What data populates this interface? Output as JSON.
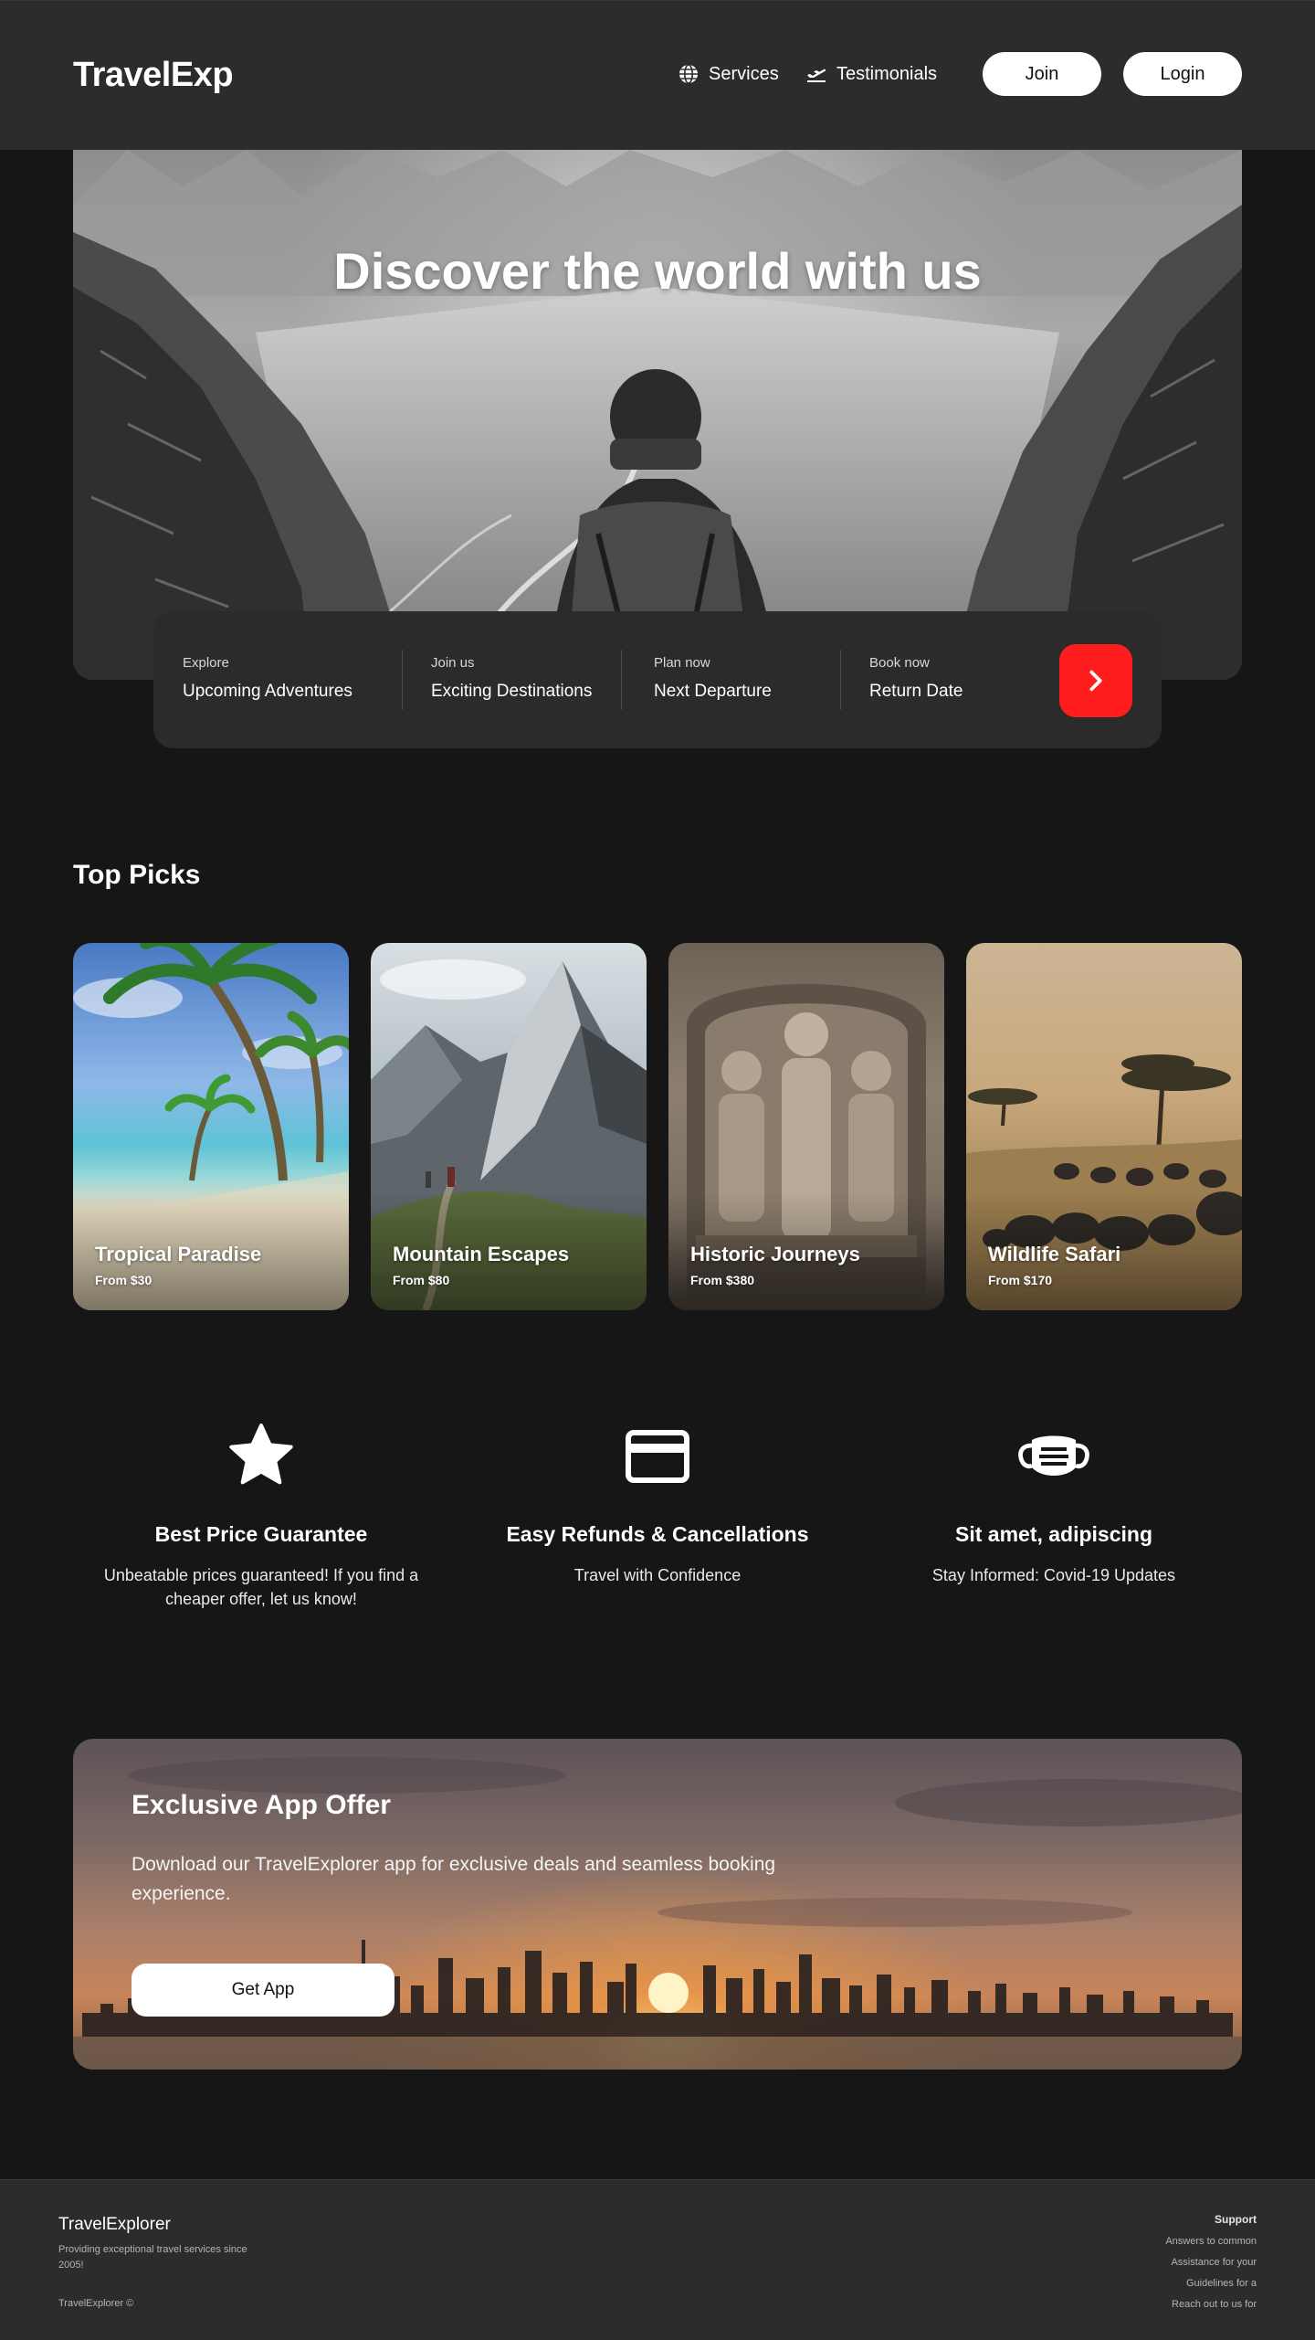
{
  "header": {
    "logo": "TravelExp",
    "nav": [
      {
        "label": "Services",
        "icon": "globe-icon"
      },
      {
        "label": "Testimonials",
        "icon": "plane-departure-icon"
      }
    ],
    "join_label": "Join",
    "login_label": "Login"
  },
  "hero": {
    "title": "Discover the world with us"
  },
  "search": {
    "fields": [
      {
        "label": "Explore",
        "value": "Upcoming Adventures"
      },
      {
        "label": "Join us",
        "value": "Exciting Destinations"
      },
      {
        "label": "Plan now",
        "value": "Next Departure"
      },
      {
        "label": "Book now",
        "value": "Return Date"
      }
    ],
    "submit_icon": "chevron-right-icon",
    "accent_color": "#ff1d1d"
  },
  "top_picks": {
    "title": "Top Picks",
    "cards": [
      {
        "title": "Tropical Paradise",
        "price": "From $30"
      },
      {
        "title": "Mountain Escapes",
        "price": "From $80"
      },
      {
        "title": "Historic Journeys",
        "price": "From $380"
      },
      {
        "title": "Wildlife Safari",
        "price": "From $170"
      }
    ]
  },
  "features": [
    {
      "icon": "star-icon",
      "title": "Best Price Guarantee",
      "desc": "Unbeatable prices guaranteed! If you find a cheaper offer, let us know!"
    },
    {
      "icon": "credit-card-icon",
      "title": "Easy Refunds & Cancellations",
      "desc": "Travel with Confidence"
    },
    {
      "icon": "face-mask-icon",
      "title": "Sit amet, adipiscing",
      "desc": "Stay Informed: Covid-19 Updates"
    }
  ],
  "offer": {
    "title": "Exclusive App Offer",
    "text": "Download our TravelExplorer app for exclusive deals and seamless booking experience.",
    "button_label": "Get App"
  },
  "footer": {
    "brand": "TravelExplorer",
    "tagline": "Providing exceptional travel services since 2005!",
    "copyright": "TravelExplorer ©",
    "support": {
      "heading": "Support",
      "items": [
        "Answers to common",
        "Assistance for your",
        "Guidelines for a",
        "Reach out to us for"
      ]
    }
  }
}
